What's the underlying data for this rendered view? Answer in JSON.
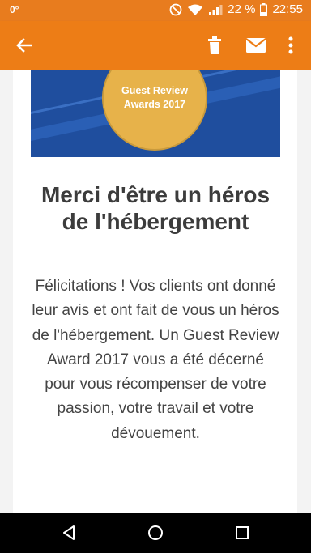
{
  "status_bar": {
    "temperature": "0°",
    "battery_percent": "22 %",
    "time": "22:55"
  },
  "app_bar": {
    "icons": [
      "arrow-back-icon",
      "trash-icon",
      "mail-icon",
      "more-vert-icon"
    ]
  },
  "banner": {
    "medal_line1": "Guest Review",
    "medal_line2": "Awards 2017"
  },
  "email": {
    "title": "Merci d'être un héros de l'hébergement",
    "body": "Félicitations ! Vos clients ont donné leur avis et ont fait de vous un héros de l'hébergement. Un Guest Review Award 2017 vous a été décerné pour vous récompenser de votre passion, votre travail et votre dévouement."
  },
  "colors": {
    "accent": "#ed7d16",
    "banner_blue": "#1f4e9e",
    "medal_gold": "#e7b24a"
  },
  "nav_bar": {
    "icons": [
      "nav-back-icon",
      "nav-home-icon",
      "nav-recents-icon"
    ]
  }
}
